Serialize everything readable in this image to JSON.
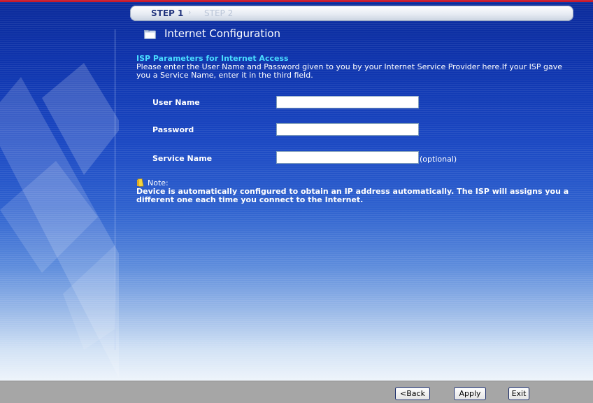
{
  "steps": {
    "step1": "STEP 1",
    "separator": "›",
    "step2": "STEP 2"
  },
  "page": {
    "title": "Internet Configuration",
    "title_icon": "folder-icon"
  },
  "isp": {
    "section_title": "ISP Parameters for Internet Access",
    "description": "Please enter the User Name and Password given to you by your Internet Service Provider here.If your ISP gave you a Service Name, enter it in the third field."
  },
  "fields": {
    "user_name": {
      "label": "User Name",
      "value": ""
    },
    "password": {
      "label": "Password",
      "value": ""
    },
    "service_name": {
      "label": "Service Name",
      "value": "",
      "hint": "(optional)"
    }
  },
  "note": {
    "label": "Note:",
    "icon": "note-icon",
    "text": "Device is automatically configured to obtain an IP address automatically. The ISP will assigns you a different one each time you connect to the Internet."
  },
  "footer": {
    "back": "<Back",
    "apply": "Apply",
    "exit": "Exit"
  },
  "colors": {
    "background_top": "#0b2a9a",
    "section_title": "#46dcff",
    "footer": "#a6a6a6",
    "accent_line": "#c8182b"
  }
}
